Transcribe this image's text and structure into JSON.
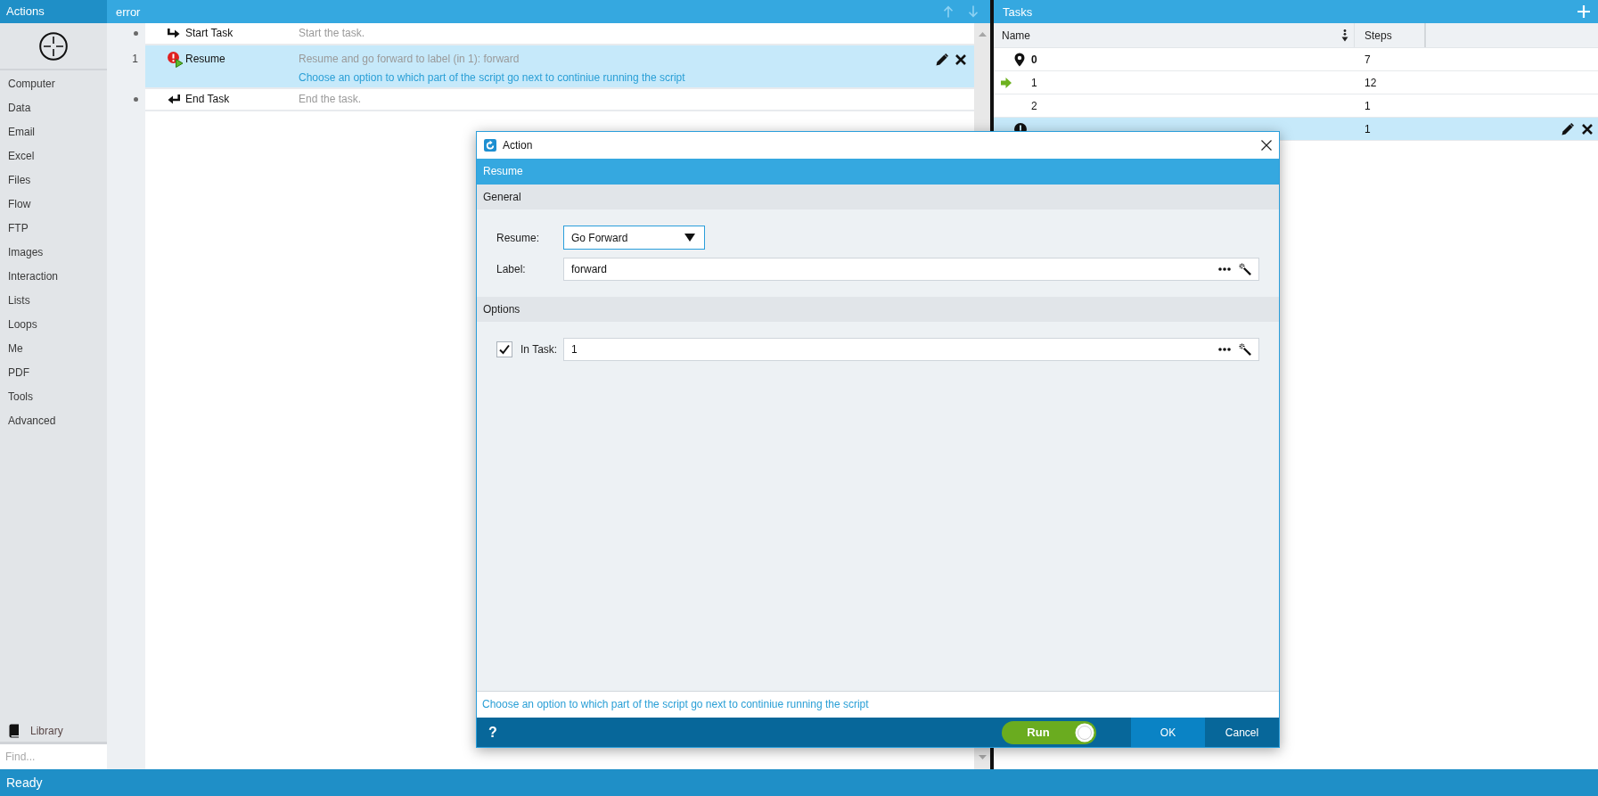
{
  "sidebar": {
    "title": "Actions",
    "items": [
      "Computer",
      "Data",
      "Email",
      "Excel",
      "Files",
      "Flow",
      "FTP",
      "Images",
      "Interaction",
      "Lists",
      "Loops",
      "Me",
      "PDF",
      "Tools",
      "Advanced"
    ],
    "library": "Library",
    "search": {
      "placeholder": "Find..."
    }
  },
  "script": {
    "title": "error",
    "steps": [
      {
        "kind": "start",
        "title": "Start Task",
        "description": "Start the task.",
        "selected": false
      },
      {
        "kind": "resume",
        "number": "1",
        "title": "Resume",
        "description": "Resume and go forward to label (in 1): forward",
        "hint": "Choose an option to which part of the script go next to continiue running the script",
        "selected": true
      },
      {
        "kind": "end",
        "title": "End Task",
        "description": "End the task.",
        "selected": false
      }
    ]
  },
  "tasks": {
    "title": "Tasks",
    "columns": [
      "Name",
      "Steps"
    ],
    "rows": [
      {
        "kind": "start",
        "name": "0",
        "steps": "7",
        "current": false,
        "selected": false
      },
      {
        "kind": "plain",
        "name": "1",
        "steps": "12",
        "current": true,
        "selected": false
      },
      {
        "kind": "plain",
        "name": "2",
        "steps": "1",
        "current": false,
        "selected": false
      },
      {
        "kind": "error",
        "steps": "1",
        "current": false,
        "selected": true
      }
    ]
  },
  "dialog": {
    "title": "Action",
    "header": "Resume",
    "sections": [
      {
        "title": "General",
        "fields": [
          {
            "kind": "dropdown",
            "label": "Resume:",
            "value": "Go Forward"
          },
          {
            "kind": "text",
            "label": "Label:",
            "value": "forward"
          }
        ]
      },
      {
        "title": "Options",
        "fields": [
          {
            "kind": "checked-text",
            "label": "In Task:",
            "value": "1",
            "checked": true
          }
        ]
      }
    ],
    "description": "Choose an option to which part of the script go next to continiue running the script",
    "help": "?",
    "run": {
      "label": "Run",
      "on": true
    },
    "buttons": [
      {
        "label": "OK",
        "primary": true
      },
      {
        "label": "Cancel",
        "primary": false
      }
    ]
  },
  "status_bar": "Ready"
}
